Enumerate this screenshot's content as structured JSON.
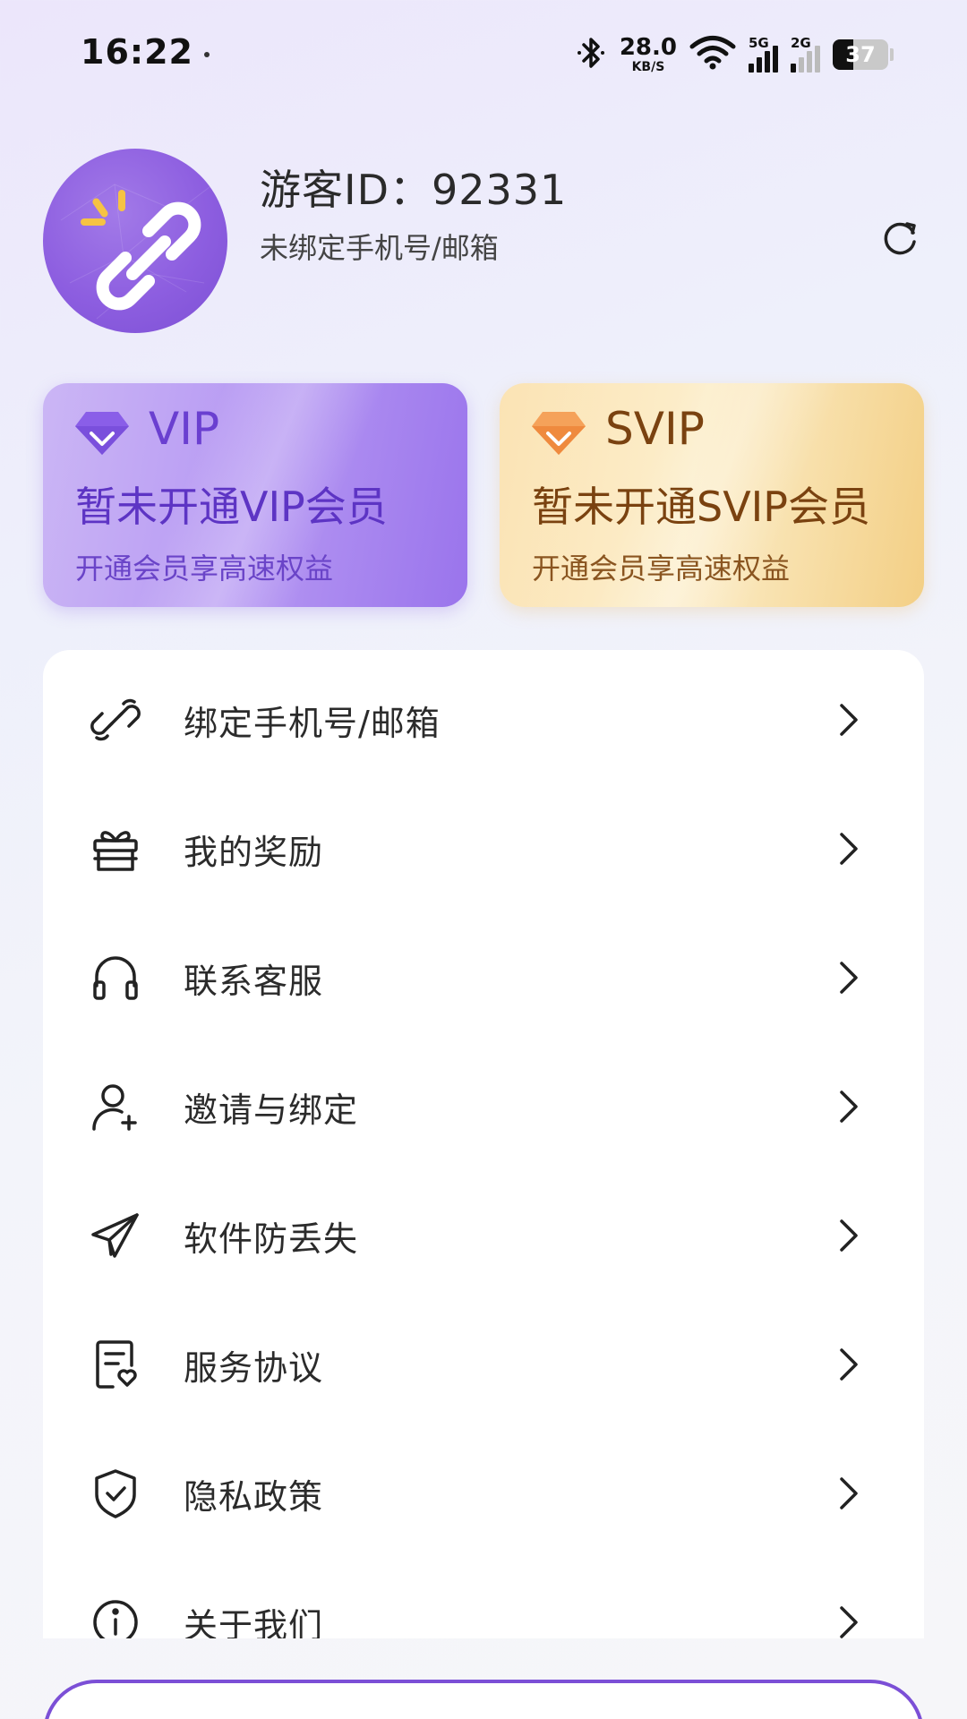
{
  "status_bar": {
    "time": "16:22",
    "net_speed_value": "28.0",
    "net_speed_unit": "KB/S",
    "signal_1_label": "5G",
    "signal_2_label": "2G",
    "battery_level": "37"
  },
  "profile": {
    "guest_id": "游客ID：92331",
    "bind_status": "未绑定手机号/邮箱"
  },
  "vip_cards": [
    {
      "tier": "VIP",
      "headline": "暂未开通VIP会员",
      "desc": "开通会员享高速权益"
    },
    {
      "tier": "SVIP",
      "headline": "暂未开通SVIP会员",
      "desc": "开通会员享高速权益"
    }
  ],
  "menu": {
    "items": [
      {
        "label": "绑定手机号/邮箱",
        "icon": "link-icon"
      },
      {
        "label": "我的奖励",
        "icon": "gift-icon"
      },
      {
        "label": "联系客服",
        "icon": "headset-icon"
      },
      {
        "label": "邀请与绑定",
        "icon": "user-plus-icon"
      },
      {
        "label": "软件防丢失",
        "icon": "send-icon"
      },
      {
        "label": "服务协议",
        "icon": "document-icon"
      },
      {
        "label": "隐私政策",
        "icon": "shield-check-icon"
      },
      {
        "label": "关于我们",
        "icon": "info-icon"
      }
    ]
  },
  "colors": {
    "accent": "#7b4fd6",
    "vip_text": "#5d34c4",
    "svip_text": "#7a4210"
  }
}
